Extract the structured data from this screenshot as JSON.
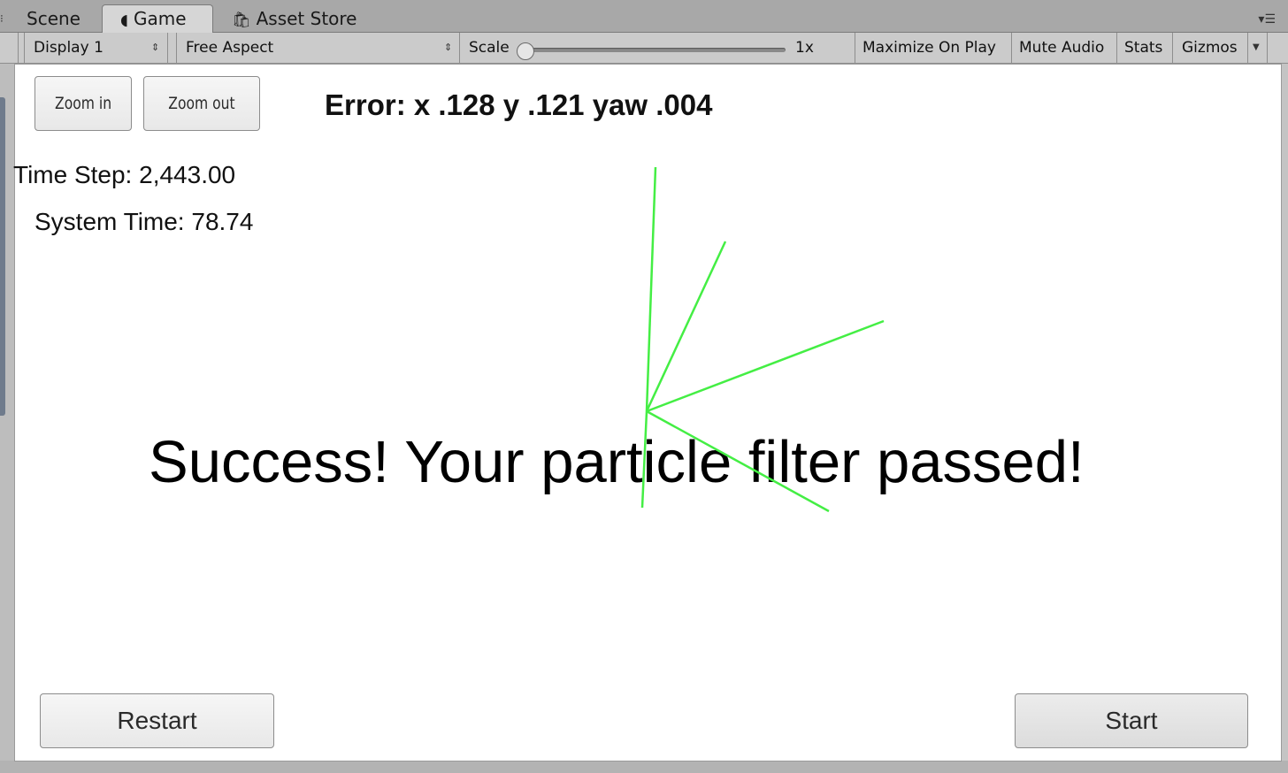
{
  "tabs": {
    "scene": "Scene",
    "game": "Game",
    "asset_store": "Asset Store"
  },
  "toolbar": {
    "display": "Display 1",
    "aspect": "Free Aspect",
    "scale_label": "Scale",
    "scale_value": "1x",
    "maximize": "Maximize On Play",
    "mute": "Mute Audio",
    "stats": "Stats",
    "gizmos": "Gizmos"
  },
  "game": {
    "zoom_in": "Zoom in",
    "zoom_out": "Zoom out",
    "error": "Error: x .128 y .121 yaw .004",
    "time_step": "Time Step: 2,443.00",
    "system_time": "System Time: 78.74",
    "success": "Success! Your particle filter passed!",
    "restart": "Restart",
    "start": "Start",
    "ray_color": "#44ee44"
  }
}
